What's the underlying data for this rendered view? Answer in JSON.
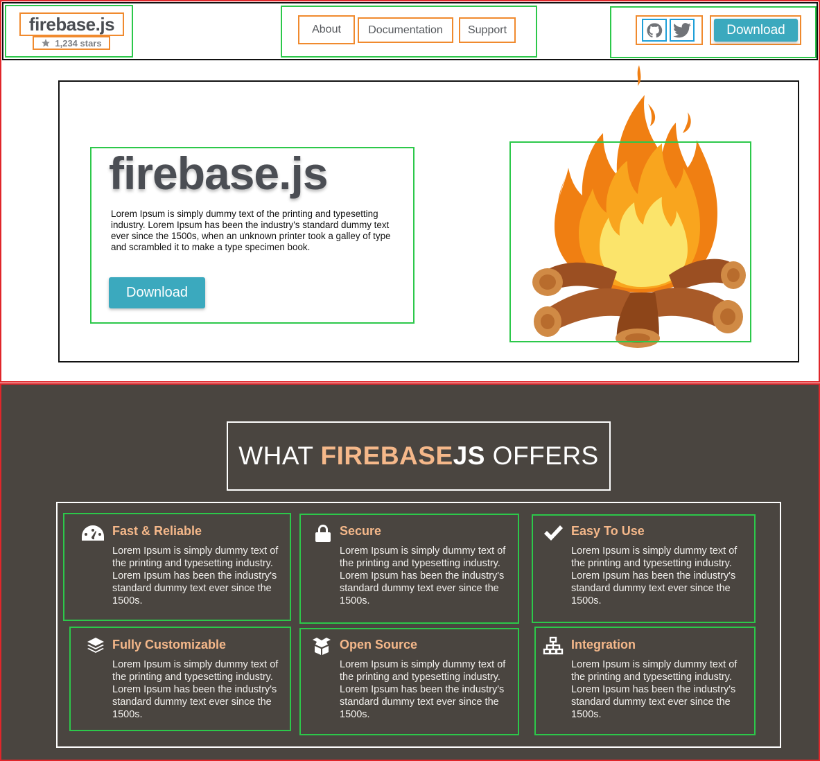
{
  "brand": {
    "title": "firebase.js",
    "stars": "1,234 stars"
  },
  "nav": {
    "items": [
      "About",
      "Documentation",
      "Support"
    ]
  },
  "social": {
    "icons": [
      "github-icon",
      "twitter-icon"
    ]
  },
  "header_download_label": "Download",
  "hero": {
    "title": "firebase.js",
    "description": "Lorem Ipsum is simply dummy text of the printing and typesetting industry. Lorem Ipsum has been the industry's standard dummy text ever since the 1500s, when an unknown printer took a galley of type and scrambled it to make a type specimen book.",
    "download_label": "Download"
  },
  "offers": {
    "title_prefix": "WHAT ",
    "title_accent": "FIREBASE",
    "title_strong": "JS",
    "title_suffix": " OFFERS"
  },
  "features": [
    {
      "icon": "speedometer-icon",
      "title": "Fast & Reliable",
      "text": "Lorem Ipsum is simply dummy text of the printing and typesetting industry. Lorem Ipsum has been the industry's standard dummy text ever since the 1500s."
    },
    {
      "icon": "lock-icon",
      "title": "Secure",
      "text": "Lorem Ipsum is simply dummy text of the printing and typesetting industry. Lorem Ipsum has been the industry's standard dummy text ever since the 1500s."
    },
    {
      "icon": "checkmark-icon",
      "title": "Easy To Use",
      "text": "Lorem Ipsum is simply dummy text of the printing and typesetting industry. Lorem Ipsum has been the industry's standard dummy text ever since the 1500s."
    },
    {
      "icon": "layers-icon",
      "title": "Fully Customizable",
      "text": "Lorem Ipsum is simply dummy text of the printing and typesetting industry. Lorem Ipsum has been the industry's standard dummy text ever since the 1500s."
    },
    {
      "icon": "open-box-icon",
      "title": "Open Source",
      "text": "Lorem Ipsum is simply dummy text of the printing and typesetting industry. Lorem Ipsum has been the industry's standard dummy text ever since the 1500s."
    },
    {
      "icon": "network-icon",
      "title": "Integration",
      "text": "Lorem Ipsum is simply dummy text of the printing and typesetting industry. Lorem Ipsum has been the industry's standard dummy text ever since the 1500s."
    }
  ],
  "colors": {
    "accent": "#3ba9be",
    "dark_bg": "#4a4540",
    "feature_title": "#f5b88a",
    "box_green": "#2cc84a",
    "box_orange": "#f08a2e",
    "box_red": "#e0262a"
  }
}
